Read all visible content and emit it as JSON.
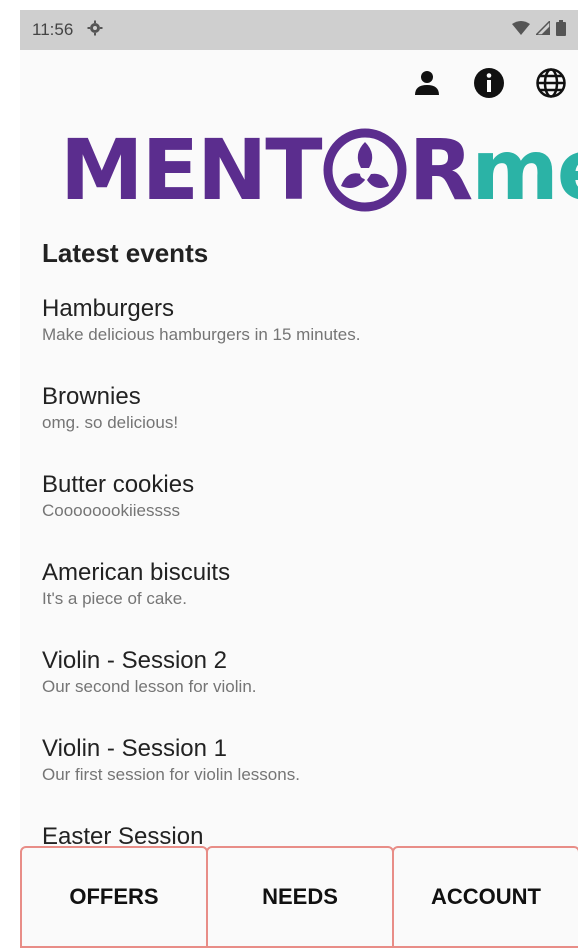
{
  "status_bar": {
    "time": "11:56",
    "icons": [
      "settings-gear-icon",
      "wifi-icon",
      "signal-icon",
      "battery-icon"
    ]
  },
  "toolbar": {
    "icons": [
      "person-icon",
      "info-icon",
      "globe-icon"
    ]
  },
  "logo": {
    "part1": "MENT",
    "part2": "R",
    "part3": "me",
    "colors": {
      "purple": "#5b2d8e",
      "teal": "#2bb3a6"
    }
  },
  "section": {
    "title": "Latest events"
  },
  "events": [
    {
      "title": "Hamburgers",
      "subtitle": "Make delicious hamburgers in 15 minutes."
    },
    {
      "title": "Brownies",
      "subtitle": "omg. so delicious!"
    },
    {
      "title": "Butter cookies",
      "subtitle": "Coooooookiiessss"
    },
    {
      "title": "American biscuits",
      "subtitle": "It's a piece of cake."
    },
    {
      "title": "Violin - Session 2",
      "subtitle": "Our second lesson for violin."
    },
    {
      "title": "Violin - Session 1",
      "subtitle": "Our first session for violin lessons."
    },
    {
      "title": "Easter Session",
      "subtitle": ""
    }
  ],
  "bottom_nav": {
    "offers": "OFFERS",
    "needs": "NEEDS",
    "account": "ACCOUNT",
    "border_color": "#e88d87"
  }
}
